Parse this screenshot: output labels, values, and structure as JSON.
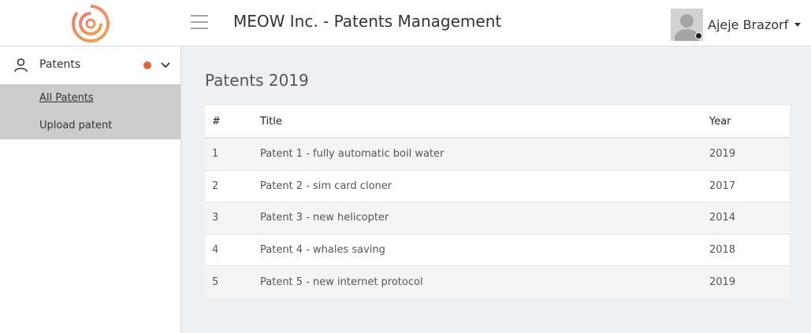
{
  "header": {
    "logo_icon": "target-logo-icon",
    "menu_icon": "hamburger-icon",
    "app_title": "MEOW Inc. - Patents Management",
    "user": {
      "name": "Ajeje Brazorf",
      "avatar_icon": "user-avatar-icon",
      "dropdown_icon": "caret-down-icon"
    }
  },
  "sidebar": {
    "section": {
      "label": "Patents",
      "icon": "user-icon",
      "badge_color": "#e8633a",
      "toggle_icon": "chevron-down-icon"
    },
    "items": [
      {
        "label": "All Patents",
        "active": true
      },
      {
        "label": "Upload patent",
        "active": false
      }
    ]
  },
  "main": {
    "title": "Patents 2019",
    "table": {
      "columns": [
        "#",
        "Title",
        "Year"
      ],
      "rows": [
        {
          "num": "1",
          "title": "Patent 1 - fully automatic boil water",
          "year": "2019"
        },
        {
          "num": "2",
          "title": "Patent 2 - sim card cloner",
          "year": "2017"
        },
        {
          "num": "3",
          "title": "Patent 3 - new helicopter",
          "year": "2014"
        },
        {
          "num": "4",
          "title": "Patent 4 - whales saving",
          "year": "2018"
        },
        {
          "num": "5",
          "title": "Patent 5 - new internet protocol",
          "year": "2019"
        }
      ]
    }
  }
}
